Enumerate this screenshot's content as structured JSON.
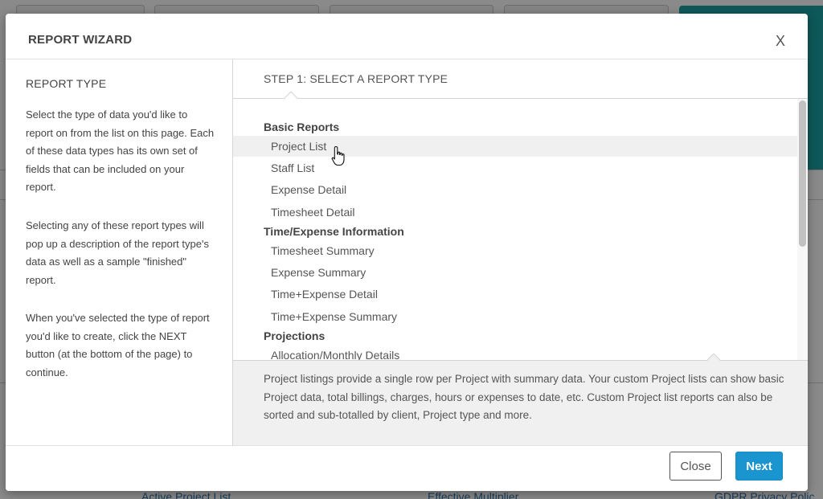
{
  "background": {
    "links": [
      "Active Project List",
      "Effective Multiplier",
      "GDPR Privacy Polic"
    ]
  },
  "modal": {
    "title": "REPORT WIZARD",
    "close_label": "X",
    "left": {
      "heading": "REPORT TYPE",
      "paragraphs": [
        "Select the type of data you'd like to report on from the list on this page. Each of these data types has its own set of fields that can be included on your report.",
        "Selecting any of these report types will pop up a description of the report type's data as well as a sample \"finished\" report.",
        "When you've selected the type of report you'd like to create, click the NEXT button (at the bottom of the page) to continue."
      ]
    },
    "step_title": "STEP 1: SELECT A REPORT TYPE",
    "groups": [
      {
        "title": "Basic Reports",
        "items": [
          "Project List",
          "Staff List",
          "Expense Detail",
          "Timesheet Detail"
        ]
      },
      {
        "title": "Time/Expense Information",
        "items": [
          "Timesheet Summary",
          "Expense Summary",
          "Time+Expense Detail",
          "Time+Expense Summary"
        ]
      },
      {
        "title": "Projections",
        "items": [
          "Allocation/Monthly Details"
        ]
      }
    ],
    "hovered_item": "Project List",
    "description": "Project listings provide a single row per Project with summary data. Your custom Project lists can show basic Project data, total billings, charges, hours or expenses to date, etc. Custom Project list reports can also be sorted and sub-totalled by client, Project type and more.",
    "footer": {
      "close_button": "Close",
      "next_button": "Next"
    }
  },
  "colors": {
    "accent": "#1a95cf",
    "teal": "#1aa3a6",
    "hover_row": "#f0f0f0"
  }
}
